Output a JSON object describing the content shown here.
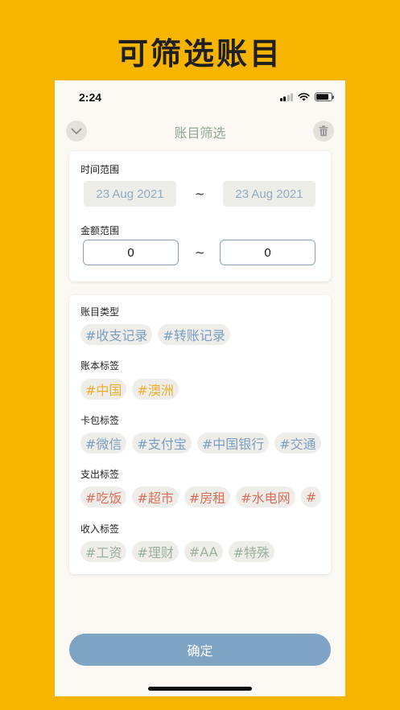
{
  "promo": {
    "title": "可筛选账目"
  },
  "status_bar": {
    "time": "2:24"
  },
  "nav": {
    "title": "账目筛选"
  },
  "filter": {
    "time_range_label": "时间范围",
    "date_start": "23 Aug 2021",
    "date_end": "23 Aug 2021",
    "separator": "~",
    "amount_range_label": "金额范围",
    "amount_min": "0",
    "amount_max": "0"
  },
  "categories": {
    "type_label": "账目类型",
    "type_tags": [
      "#收支记录",
      "#转账记录"
    ],
    "book_label": "账本标签",
    "book_tags": [
      "#中国",
      "#澳洲"
    ],
    "card_label": "卡包标签",
    "card_tags": [
      "#微信",
      "#支付宝",
      "#中国银行",
      "#交通"
    ],
    "expense_label": "支出标签",
    "expense_tags": [
      "#吃饭",
      "#超市",
      "#房租",
      "#水电网",
      "#"
    ],
    "income_label": "收入标签",
    "income_tags": [
      "#工资",
      "#理财",
      "#AA",
      "#特殊"
    ]
  },
  "actions": {
    "confirm_label": "确定"
  },
  "colors": {
    "background": "#F7B500",
    "accent_blue": "#7FA3C2",
    "tag_blue": "#7B9FC1",
    "tag_orange": "#EDAF2F",
    "tag_red": "#D9705A",
    "tag_green": "#9BB09B"
  },
  "icons": {
    "back": "chevron-down-icon",
    "trash": "trash-icon",
    "wifi": "wifi-icon",
    "battery": "battery-icon",
    "signal": "signal-icon"
  }
}
